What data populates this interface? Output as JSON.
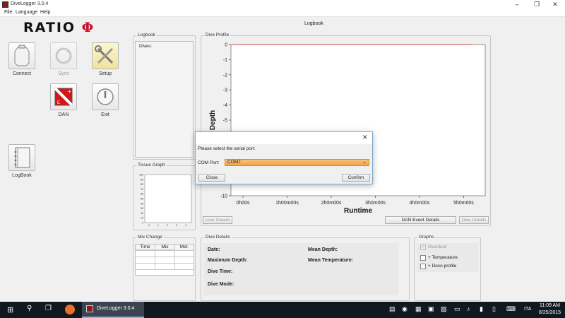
{
  "window": {
    "title": "DiveLogger 3.0.4"
  },
  "menu": [
    "File",
    "Language",
    "Help"
  ],
  "logo": {
    "text": "RATIO",
    "symbol": "Φ"
  },
  "toolbar": {
    "connect": "Connect",
    "sync": "Sync",
    "setup": "Setup",
    "dan": "DAN",
    "exit": "Exit",
    "logbook": "LogBook"
  },
  "header_label": "Logbook",
  "logbook": {
    "title": "Logbook",
    "list_header": "Dives:"
  },
  "tissue_graph": {
    "title": "Tissue Graph",
    "y_ticks": [
      "100",
      "90",
      "80",
      "70",
      "60",
      "50",
      "40",
      "30",
      "20",
      "10",
      "0"
    ],
    "x_ticks": [
      "0",
      "1",
      "2",
      "3",
      "4",
      "5"
    ]
  },
  "dive_profile": {
    "title": "Dive Profile",
    "user_details": "User Details",
    "dan_event_details": "DAN Event Details",
    "dive_details_btn": "Dive Details"
  },
  "chart_data": {
    "type": "line",
    "title": "",
    "xlabel": "Runtime",
    "ylabel": "Depth",
    "x_ticks": [
      "0h00s",
      "1h00m00s",
      "2h0m00s",
      "3h0m00s",
      "4h0m00s",
      "5h0m00s"
    ],
    "y_ticks": [
      "0",
      "-1",
      "-2",
      "-3",
      "-4",
      "-5",
      "-6",
      "-7",
      "-8",
      "-9",
      "-10"
    ],
    "ylim": [
      -10,
      0
    ],
    "series": [
      {
        "x": [
          0,
          1,
          2,
          3,
          4,
          5
        ],
        "values": [
          0,
          0,
          0,
          0,
          0,
          0
        ],
        "color": "#d04040"
      }
    ]
  },
  "dialog": {
    "prompt": "Please select the serial port:",
    "com_label": "COM Port:",
    "com_value": "COM7",
    "close": "Close",
    "confirm": "Confirm"
  },
  "mix_change": {
    "title": "Mix Change",
    "columns": [
      "Time",
      "Mix",
      "Met."
    ]
  },
  "dive_details": {
    "title": "Dive Details",
    "date": "Date:",
    "max_depth": "Maximum Depth:",
    "dive_time": "Dive Time:",
    "dive_mode": "Dive Mode:",
    "mean_depth": "Mean Depth:",
    "mean_temp": "Mean Temperature:"
  },
  "graphs": {
    "title": "Graphs",
    "standard": "Standard",
    "temperature": "+ Temperature",
    "deco": "+ Deco profile"
  },
  "taskbar": {
    "app": "DiveLogger 3.0.4",
    "lang": "ITA",
    "time": "11:09 AM",
    "date": "8/25/2015"
  },
  "colors": {
    "accent_orange": "#f0a34a",
    "brand_red": "#c8102e",
    "taskbar": "#101820"
  }
}
